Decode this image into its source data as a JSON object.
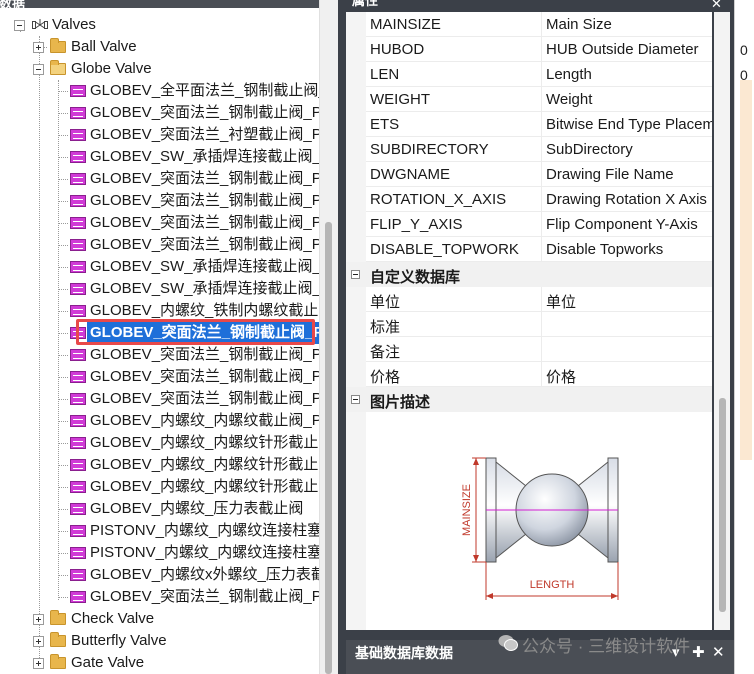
{
  "tree": {
    "panel_title": "库数据",
    "root": "Valves",
    "groups": {
      "ball_valve": "Ball Valve",
      "globe_valve": "Globe Valve",
      "check_valve": "Check Valve",
      "butterfly_valve": "Butterfly Valve",
      "gate_valve": "Gate Valve"
    },
    "globe_items": [
      "GLOBEV_全平面法兰_钢制截止阀_",
      "GLOBEV_突面法兰_钢制截止阀_PN",
      "GLOBEV_突面法兰_衬塑截止阀_PN",
      "GLOBEV_SW_承插焊连接截止阀_P",
      "GLOBEV_突面法兰_钢制截止阀_PN",
      "GLOBEV_突面法兰_钢制截止阀_PN",
      "GLOBEV_突面法兰_钢制截止阀_PN",
      "GLOBEV_突面法兰_钢制截止阀_PN",
      "GLOBEV_SW_承插焊连接截止阀_P",
      "GLOBEV_SW_承插焊连接截止阀_P",
      "GLOBEV_内螺纹_铁制内螺纹截止阀",
      "GLOBEV_突面法兰_钢制截止阀_P",
      "GLOBEV_突面法兰_钢制截止阀_PN",
      "GLOBEV_突面法兰_钢制截止阀_PN",
      "GLOBEV_突面法兰_钢制截止阀_PN",
      "GLOBEV_内螺纹_内螺纹截止阀_PN",
      "GLOBEV_内螺纹_内螺纹针形截止阀",
      "GLOBEV_内螺纹_内螺纹针形截止阀",
      "GLOBEV_内螺纹_内螺纹针形截止阀",
      "GLOBEV_内螺纹_压力表截止阀",
      "PISTONV_内螺纹_内螺纹连接柱塞",
      "PISTONV_内螺纹_内螺纹连接柱塞",
      "GLOBEV_内螺纹x外螺纹_压力表截",
      "GLOBEV_突面法兰_钢制截止阀_PN"
    ],
    "selected_index": 11
  },
  "properties": {
    "panel_title": "属性",
    "close_glyph": "✕",
    "basic_rows": [
      {
        "key": "MAINSIZE",
        "value": "Main Size"
      },
      {
        "key": "HUBOD",
        "value": "HUB Outside Diameter"
      },
      {
        "key": "LEN",
        "value": "Length"
      },
      {
        "key": "WEIGHT",
        "value": "Weight"
      },
      {
        "key": "ETS",
        "value": "Bitwise End Type Placement"
      },
      {
        "key": "SUBDIRECTORY",
        "value": "SubDirectory"
      },
      {
        "key": "DWGNAME",
        "value": "Drawing File Name"
      },
      {
        "key": "ROTATION_X_AXIS",
        "value": "Drawing Rotation X Axis"
      },
      {
        "key": "FLIP_Y_AXIS",
        "value": "Flip Component Y-Axis"
      },
      {
        "key": "DISABLE_TOPWORK",
        "value": "Disable Topworks"
      }
    ],
    "custom_db_category": "自定义数据库",
    "custom_rows": [
      {
        "key": "单位",
        "value": "单位"
      },
      {
        "key": "标准",
        "value": ""
      },
      {
        "key": "备注",
        "value": ""
      },
      {
        "key": "价格",
        "value": "价格"
      }
    ],
    "image_category": "图片描述",
    "drawing": {
      "mainsize_label": "MAINSIZE",
      "length_label": "LENGTH"
    }
  },
  "bottom_panel": {
    "title": "基础数据库数据",
    "pin_glyph": "▾",
    "dock_glyph": "✚",
    "close_glyph": "✕"
  },
  "watermark": "公众号 · 三维设计软件",
  "right_sliver": {
    "digits": [
      "0",
      "0"
    ]
  },
  "colors": {
    "selection": "#1e6fd9",
    "highlight_box": "#e8494a",
    "panel_dark": "#3b4048",
    "dim_red": "#c0392b",
    "center_magenta": "#d21ed2"
  }
}
